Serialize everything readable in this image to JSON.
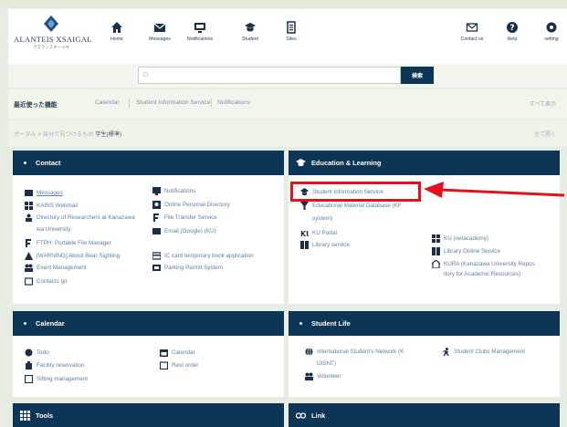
{
  "header": {
    "logo_text": "ALANTEIS XSAIGAL",
    "logo_sub": "ラズランスキーャキ",
    "nav": [
      {
        "label": "Home",
        "icon": "home-icon"
      },
      {
        "label": "Messages",
        "icon": "envelope-icon"
      },
      {
        "label": "Notifications",
        "icon": "monitor-icon"
      },
      {
        "label": "Student",
        "icon": "graduation-cap-icon"
      },
      {
        "label": "Sites",
        "icon": "list-icon"
      }
    ],
    "right_nav": [
      {
        "label": "Contact us",
        "icon": "mail-icon"
      },
      {
        "label": "Help",
        "icon": "help-icon"
      },
      {
        "label": "setting",
        "icon": "settings-icon"
      }
    ]
  },
  "search": {
    "placeholder": "□",
    "button": "検索"
  },
  "recent": {
    "title": "最近使った機能",
    "links": [
      "Calendar",
      "Student Information Service",
      "Notifications"
    ],
    "more": "すべて表示"
  },
  "breadcrumb": {
    "prefix": "ポータル > 自分で見つけるもの",
    "current": "学生(標準)",
    "expand": "全て開く"
  },
  "panels": {
    "contact": {
      "title": "Contact",
      "items_left": [
        "Messages",
        "KAINS Webmail",
        "Directory of Researchers at Kanazawa",
        "wa University",
        "FTPH: Portable File Manager",
        "[WARNING] About Bear Sighting",
        "Event Management",
        "Contacts go"
      ],
      "items_right": [
        "Notifications",
        "Online Personal Directory",
        "File Transfer Service",
        "Email (Google) (KU)",
        "IC card temporary book application",
        "Parking Permit System"
      ]
    },
    "education": {
      "title": "Education & Learning",
      "items_left": [
        "Student Information Service",
        "Educational Material Database (KF",
        "system)",
        "KU Portal",
        "Library service"
      ],
      "items_right": [
        "KU (netacademy)",
        "Library Online Service",
        "KURA (Kanazawa University Repos",
        "itory for Academic Resources)"
      ]
    },
    "calendar": {
      "title": "Calendar",
      "items_left": [
        "Todo",
        "Facility reservation",
        "Sitting management"
      ],
      "items_right": [
        "Calendar",
        "Rest order"
      ]
    },
    "student_life": {
      "title": "Student Life",
      "items_left": [
        "International Student's Network (K",
        "UISNT)",
        "Volunteer"
      ],
      "items_right": [
        "Student Clubs Management"
      ]
    },
    "tools": {
      "title": "Tools"
    },
    "link": {
      "title": "Link"
    }
  },
  "colors": {
    "panel_header": "#0d3556",
    "link": "#5e7fa6",
    "highlight": "#e4101c"
  }
}
